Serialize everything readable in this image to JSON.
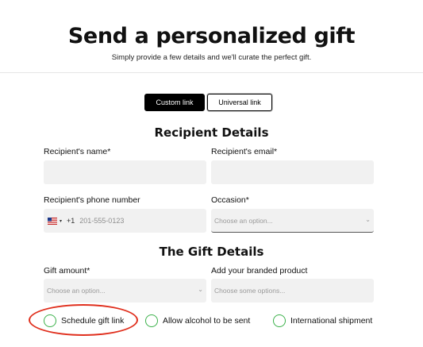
{
  "header": {
    "title": "Send a personalized gift",
    "subtitle": "Simply provide a few details and we'll curate the perfect gift."
  },
  "tabs": {
    "custom_label": "Custom link",
    "universal_label": "Universal link",
    "active": "Custom link"
  },
  "recipient": {
    "heading": "Recipient Details",
    "name_label": "Recipient's name*",
    "name_value": "",
    "email_label": "Recipient's email*",
    "email_value": "",
    "phone_label": "Recipient's phone number",
    "phone_country_code": "+1",
    "phone_placeholder": "201-555-0123",
    "occasion_label": "Occasion*",
    "occasion_placeholder": "Choose an option..."
  },
  "gift": {
    "heading": "The Gift Details",
    "amount_label": "Gift amount*",
    "amount_placeholder": "Choose an option...",
    "product_label": "Add your branded product",
    "product_placeholder": "Choose some options..."
  },
  "options": [
    {
      "label": "Schedule gift link",
      "checked": false
    },
    {
      "label": "Allow alcohol to be sent",
      "checked": false
    },
    {
      "label": "International shipment",
      "checked": false
    }
  ],
  "colors": {
    "primary_button": "#000000",
    "option_circle": "#3bb14a",
    "highlight_annotation": "#e0301e",
    "field_background": "#f1f1f1"
  }
}
